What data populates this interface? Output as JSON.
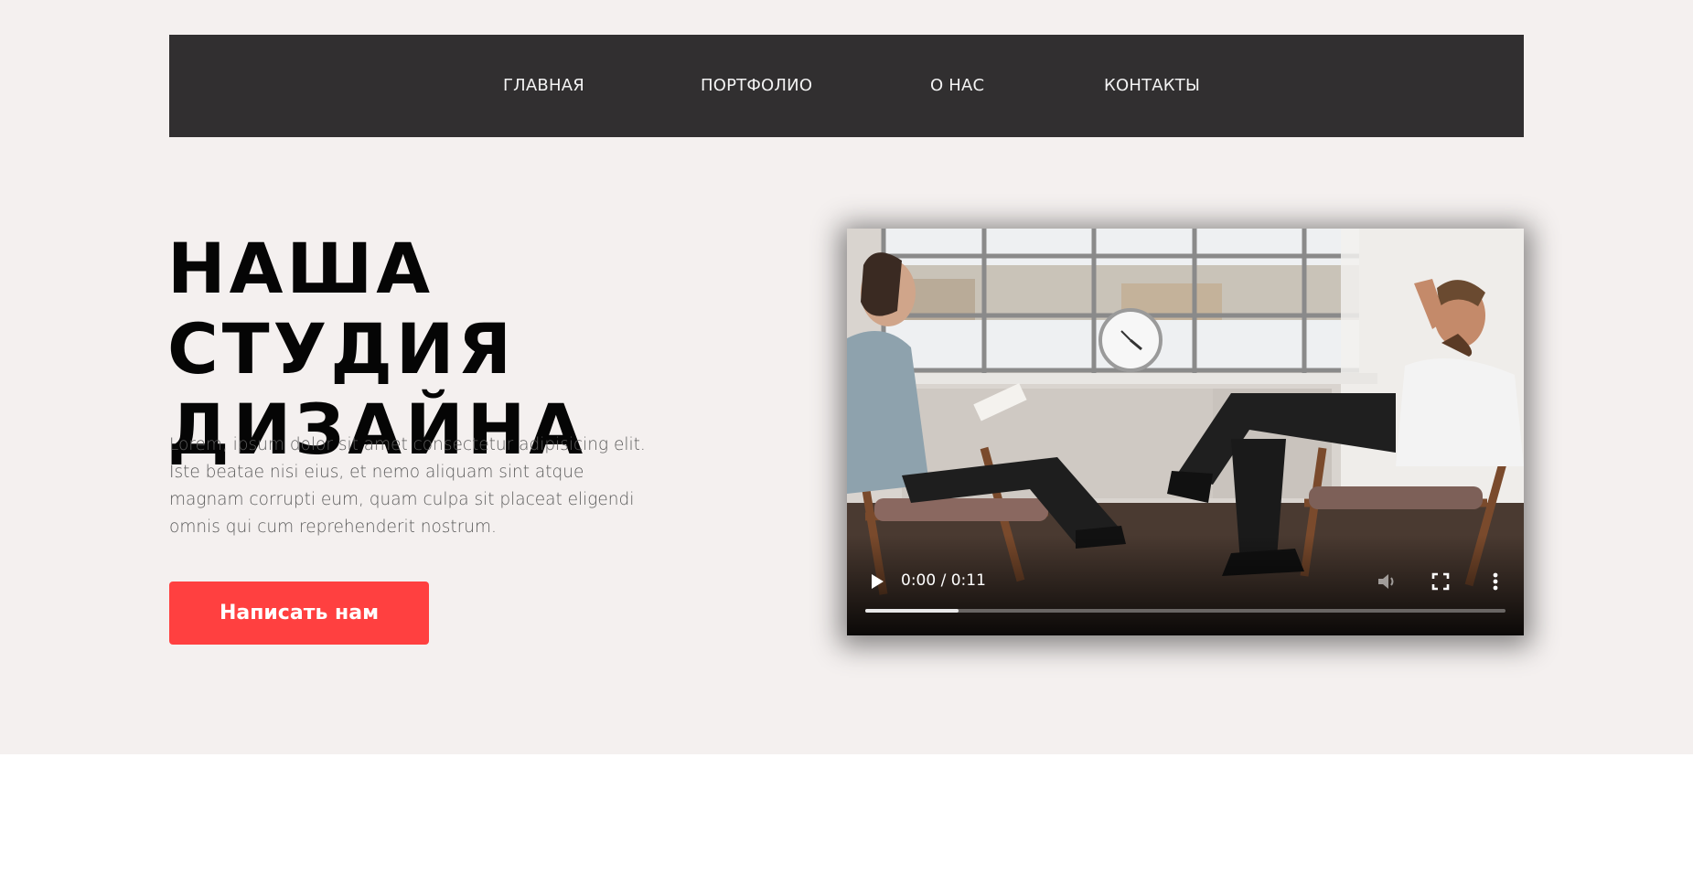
{
  "nav": {
    "items": [
      {
        "label": "ГЛАВНАЯ"
      },
      {
        "label": "ПОРТФОЛИО"
      },
      {
        "label": "О НАС"
      },
      {
        "label": "КОНТАКТЫ"
      }
    ]
  },
  "hero": {
    "title": "НАША СТУДИЯ ДИЗАЙНА",
    "text": "Lorem, ipsum dolor sit amet consectetur adipisicing elit. Iste beatae nisi eius, et nemo aliquam sint atque magnam corrupti eum, quam culpa sit placeat eligendi omnis qui cum reprehenderit nostrum.",
    "cta_label": "Написать нам"
  },
  "video": {
    "time": "0:00 / 0:11",
    "buffered_fraction": 0.145,
    "icons": {
      "play": "play-icon",
      "mute": "volume-icon",
      "fullscreen": "fullscreen-icon",
      "more": "more-vertical-icon"
    }
  },
  "colors": {
    "hero_background": "#f4f0ef",
    "nav_background": "#312f30",
    "accent": "#ff4040"
  }
}
